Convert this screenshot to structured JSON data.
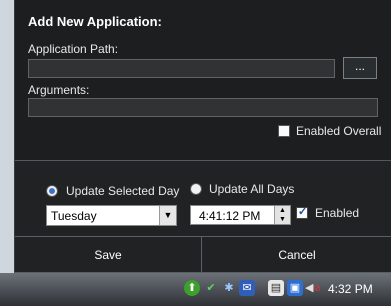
{
  "dialog": {
    "title": "Add New Application:",
    "app_path_label": "Application Path:",
    "app_path_value": "",
    "browse_label": "...",
    "arguments_label": "Arguments:",
    "arguments_value": "",
    "enabled_overall_label": "Enabled Overall",
    "enabled_overall_checked": false
  },
  "schedule": {
    "update_selected_day_label": "Update Selected Day",
    "update_all_days_label": "Update All Days",
    "selected_mode": "Update Selected Day",
    "day_value": "Tuesday",
    "time_value": "4:41:12 PM",
    "enabled_label": "Enabled",
    "enabled_checked": true
  },
  "buttons": {
    "save": "Save",
    "cancel": "Cancel"
  },
  "taskbar": {
    "clock": "4:32 PM",
    "tray_icons": [
      "app-tray-icon",
      "network-check-icon",
      "bluetooth-icon",
      "mail-icon",
      "clipboard-icon",
      "network-icon",
      "volume-muted-icon"
    ]
  },
  "colors": {
    "panel": "#202224",
    "radio_selected": "#3a74c8",
    "taskbar": "#3a3e44"
  }
}
